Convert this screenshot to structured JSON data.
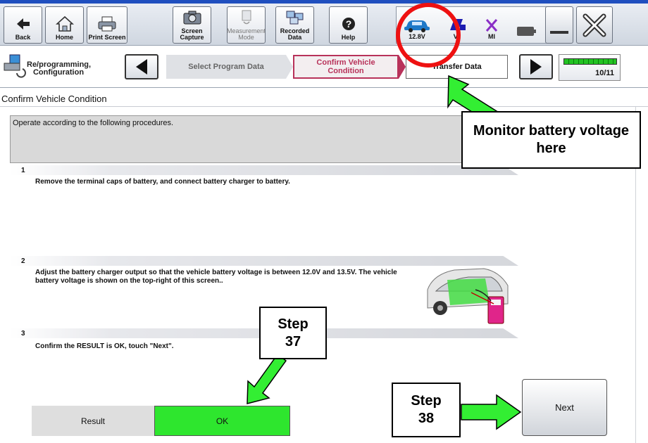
{
  "toolbar": {
    "back": "Back",
    "home": "Home",
    "print_screen": "Print Screen",
    "screen_capture": "Screen\nCapture",
    "measurement_mode": "Measurement\nMode",
    "recorded_data": "Recorded\nData",
    "help": "Help"
  },
  "status": {
    "battery_voltage": "12.8V",
    "vi": "VI",
    "mi": "MI"
  },
  "breadcrumb": {
    "section": "Re/programming,\nConfiguration",
    "step_prev": "Select Program Data",
    "step_current": "Confirm Vehicle\nCondition",
    "step_next": "Transfer Data",
    "progress": "10/11",
    "progress_fraction": 1.0
  },
  "page": {
    "title": "Confirm Vehicle Condition",
    "instruction": "Operate according to the following procedures."
  },
  "steps": [
    {
      "num": "1",
      "text": "Remove the terminal caps of battery, and connect battery charger to battery."
    },
    {
      "num": "2",
      "text": "Adjust the battery charger output so that the vehicle battery voltage is between 12.0V and 13.5V. The vehicle battery voltage is shown on the top-right of this screen.."
    },
    {
      "num": "3",
      "text": "Confirm the RESULT is OK, touch \"Next\"."
    }
  ],
  "result": {
    "label": "Result",
    "value": "OK"
  },
  "next_label": "Next",
  "annotations": {
    "battery": "Monitor battery voltage here",
    "step37": "Step\n37",
    "step38": "Step\n38"
  },
  "colors": {
    "ok_green": "#2ee62e",
    "arrow_green": "#33ee33",
    "highlight_red": "#ee1111",
    "current_step": "#b8325a"
  }
}
